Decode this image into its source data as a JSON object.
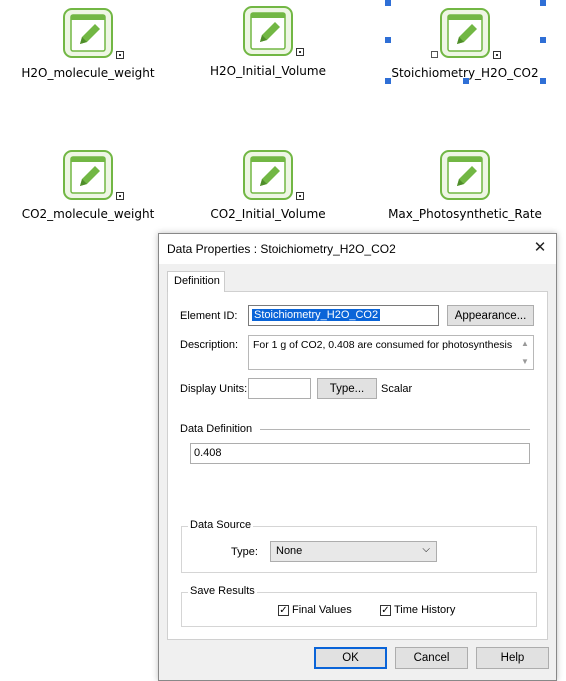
{
  "canvas": {
    "nodes": [
      {
        "label": "H2O_molecule_weight"
      },
      {
        "label": "H2O_Initial_Volume"
      },
      {
        "label": "Stoichiometry_H2O_CO2"
      },
      {
        "label": "CO2_molecule_weight"
      },
      {
        "label": "CO2_Initial_Volume"
      },
      {
        "label": "Max_Photosynthetic_Rate"
      }
    ],
    "icon_name": "pencil-note-icon",
    "colors": {
      "icon_green": "#72b744",
      "icon_bg": "#eef6e4",
      "selection": "#2f6fd6"
    }
  },
  "dialog": {
    "title": "Data Properties : Stoichiometry_H2O_CO2",
    "close_icon": "close-icon",
    "tab_definition": "Definition",
    "element_id_label": "Element ID:",
    "element_id_value": "Stoichiometry_H2O_CO2",
    "appearance_button": "Appearance...",
    "description_label": "Description:",
    "description_value": "For 1 g of CO2, 0.408 are consumed for photosynthesis",
    "display_units_label": "Display Units:",
    "display_units_value": "",
    "type_button": "Type...",
    "type_value": "Scalar",
    "data_definition_label": "Data Definition",
    "data_definition_value": "0.408",
    "data_source": {
      "title": "Data Source",
      "type_label": "Type:",
      "type_value": "None"
    },
    "save_results": {
      "title": "Save Results",
      "final_values_label": "Final Values",
      "final_values_checked": true,
      "time_history_label": "Time History",
      "time_history_checked": true
    },
    "buttons": {
      "ok": "OK",
      "cancel": "Cancel",
      "help": "Help"
    }
  }
}
